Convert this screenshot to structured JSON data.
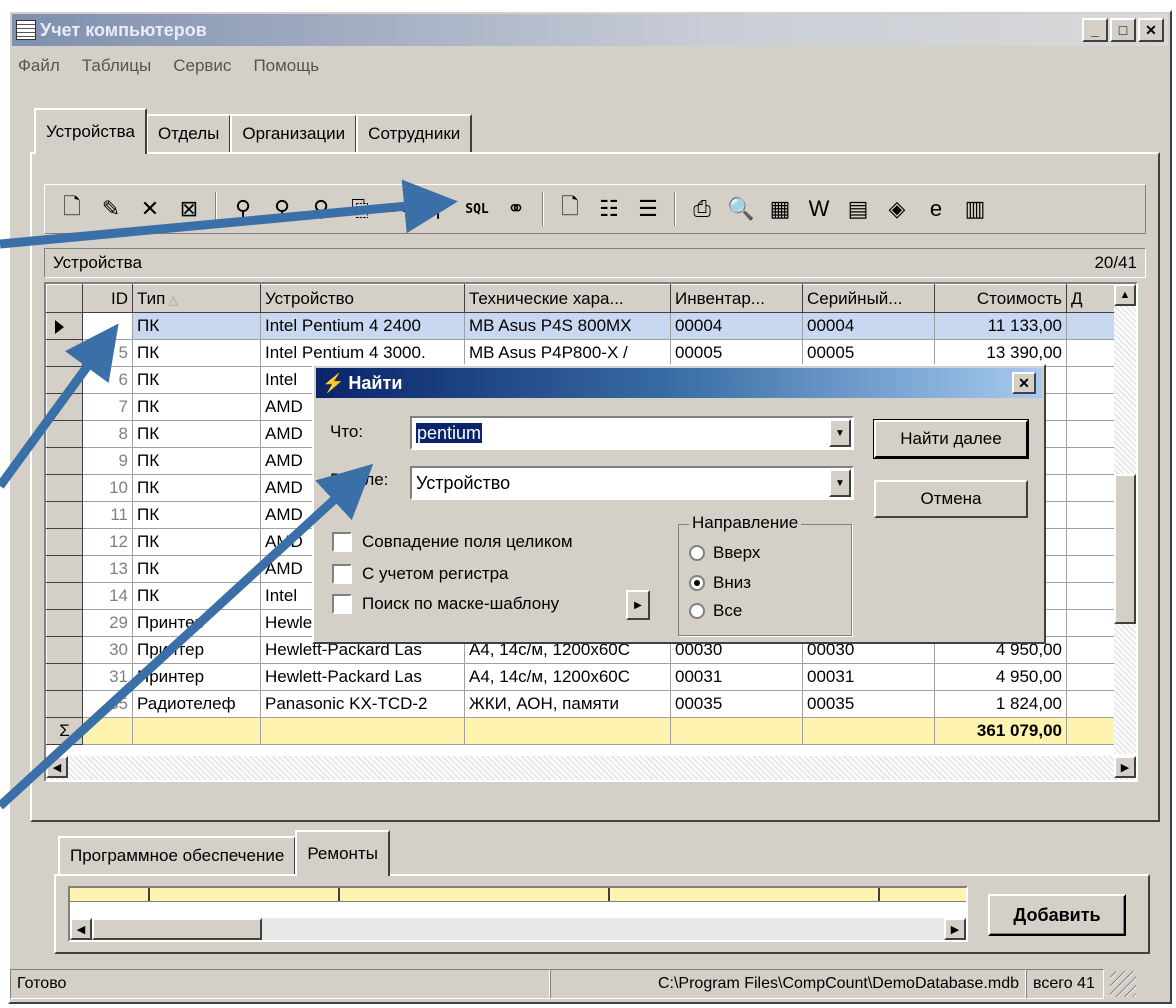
{
  "window": {
    "title": "Учет компьютеров"
  },
  "menu": [
    "Файл",
    "Таблицы",
    "Сервис",
    "Помощь"
  ],
  "tabs": [
    "Устройства",
    "Отделы",
    "Организации",
    "Сотрудники"
  ],
  "toolbar": [
    {
      "name": "new-record-icon",
      "glyph": "🗋"
    },
    {
      "name": "edit-icon",
      "glyph": "✎"
    },
    {
      "name": "delete-icon",
      "glyph": "✕"
    },
    {
      "name": "delete-all-icon",
      "glyph": "⊠"
    },
    {
      "sep": true
    },
    {
      "name": "filter-icon",
      "glyph": "⚲"
    },
    {
      "name": "remove-filter-icon",
      "glyph": "⚲"
    },
    {
      "name": "clear-filter-icon",
      "glyph": "⚲"
    },
    {
      "name": "copy-icon",
      "glyph": "⎘"
    },
    {
      "name": "tree-search-icon",
      "glyph": "⚯"
    },
    {
      "name": "advanced-filter-icon",
      "glyph": "⚲"
    },
    {
      "name": "sql-icon",
      "glyph": "SQL",
      "sql": true
    },
    {
      "name": "binoculars-icon",
      "glyph": "⚭"
    },
    {
      "sep": true
    },
    {
      "name": "new-document-icon",
      "glyph": "🗋"
    },
    {
      "name": "properties-icon",
      "glyph": "☷"
    },
    {
      "name": "settings-icon",
      "glyph": "☰"
    },
    {
      "sep": true
    },
    {
      "name": "print-icon",
      "glyph": "⎙"
    },
    {
      "name": "print-preview-icon",
      "glyph": "🔍"
    },
    {
      "name": "excel-icon",
      "glyph": "▦"
    },
    {
      "name": "word-icon",
      "glyph": "W"
    },
    {
      "name": "word-export-icon",
      "glyph": "▤"
    },
    {
      "name": "export-icon",
      "glyph": "◈"
    },
    {
      "name": "browser-icon",
      "glyph": "e"
    },
    {
      "name": "chart-icon",
      "glyph": "▥"
    }
  ],
  "grid": {
    "caption": "Устройства",
    "counter": "20/41",
    "columns": [
      "ID",
      "Тип",
      "Устройство",
      "Технические хара...",
      "Инвентар...",
      "Серийный...",
      "Стоимость",
      "Д"
    ],
    "rows": [
      [
        "",
        "ПК",
        "Intel Pentium 4 2400",
        "MB Asus P4S 800MX",
        "00004",
        "00004",
        "11 133,00"
      ],
      [
        "5",
        "ПК",
        "Intel Pentium 4 3000.",
        "MB Asus P4P800-X /",
        "00005",
        "00005",
        "13 390,00"
      ],
      [
        "6",
        "ПК",
        "Intel",
        "",
        "",
        "",
        ""
      ],
      [
        "7",
        "ПК",
        "AMD",
        "",
        "",
        "",
        ""
      ],
      [
        "8",
        "ПК",
        "AMD",
        "",
        "",
        "",
        ""
      ],
      [
        "9",
        "ПК",
        "AMD",
        "",
        "",
        "",
        ""
      ],
      [
        "10",
        "ПК",
        "AMD",
        "",
        "",
        "",
        ""
      ],
      [
        "11",
        "ПК",
        "AMD",
        "",
        "",
        "",
        ""
      ],
      [
        "12",
        "ПК",
        "AMD",
        "",
        "",
        "",
        ""
      ],
      [
        "13",
        "ПК",
        "AMD",
        "",
        "",
        "",
        ""
      ],
      [
        "14",
        "ПК",
        "Intel",
        "",
        "",
        "",
        ""
      ],
      [
        "29",
        "Принтер",
        "Hewlett-Packard Las",
        "",
        "",
        "",
        ""
      ],
      [
        "30",
        "Принтер",
        "Hewlett-Packard Las",
        "A4, 14с/м, 1200x60С",
        "00030",
        "00030",
        "4 950,00"
      ],
      [
        "31",
        "Принтер",
        "Hewlett-Packard Las",
        "A4, 14с/м, 1200x60С",
        "00031",
        "00031",
        "4 950,00"
      ],
      [
        "35",
        "Радиотелеф",
        "Panasonic KX-TCD-2",
        "ЖКИ, АОН, памяти",
        "00035",
        "00035",
        "1 824,00"
      ]
    ],
    "sum_symbol": "Σ",
    "total": "361 079,00"
  },
  "bottom_tabs": [
    "Программное обеспечение",
    "Ремонты"
  ],
  "add_button": "Добавить",
  "status": {
    "ready": "Готово",
    "path": "C:\\Program Files\\CompCount\\DemoDatabase.mdb",
    "total": "всего 41"
  },
  "find_dialog": {
    "title": "Найти",
    "what_label": "Что:",
    "what_value": "pentium",
    "field_label": "В поле:",
    "field_value": "Устройство",
    "find_next": "Найти далее",
    "cancel": "Отмена",
    "match_whole": "Совпадение поля целиком",
    "match_case": "С учетом регистра",
    "mask_search": "Поиск по маске-шаблону",
    "direction_label": "Направление",
    "dir_up": "Вверх",
    "dir_down": "Вниз",
    "dir_all": "Все",
    "selected_direction": "Вниз"
  },
  "colors": {
    "arrow": "#3b6fa8",
    "selection": "#c8d8f0",
    "total_row": "#fff3b0"
  }
}
